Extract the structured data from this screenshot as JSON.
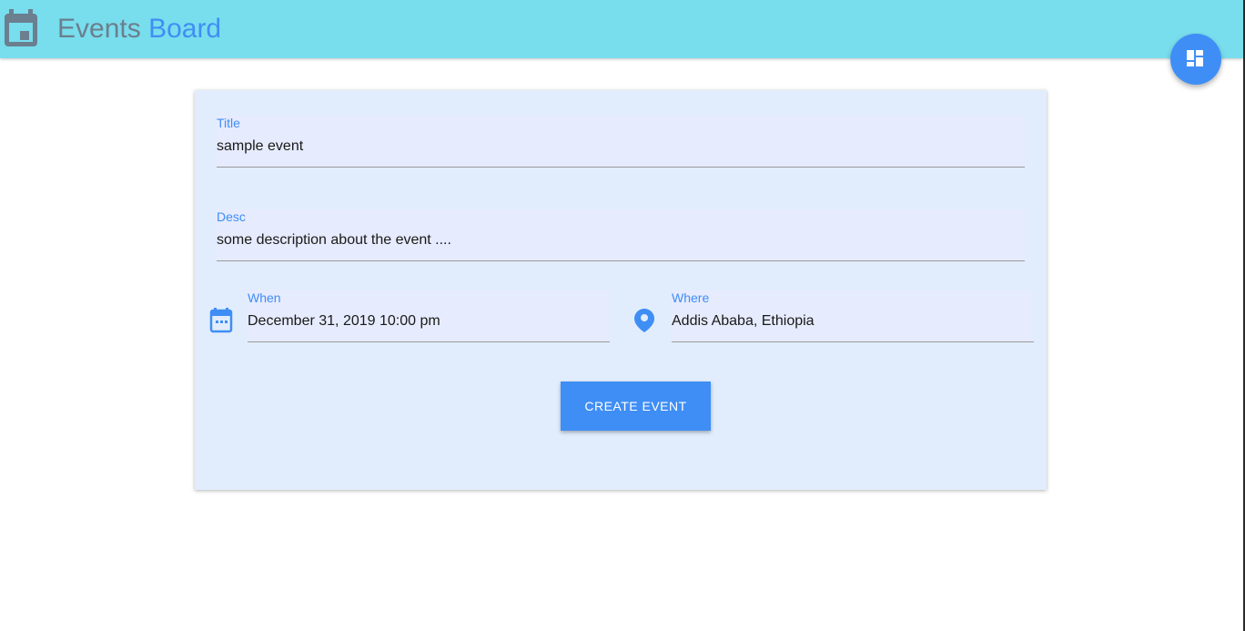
{
  "header": {
    "title_part1": "Events",
    "title_part2": "Board",
    "app_icon": "calendar-icon",
    "fab_icon": "dashboard-icon"
  },
  "form": {
    "title": {
      "label": "Title",
      "value": "sample event"
    },
    "desc": {
      "label": "Desc",
      "value": "some description about the event ...."
    },
    "when": {
      "label": "When",
      "value": "December 31, 2019 10:00 pm",
      "icon": "calendar-icon"
    },
    "where": {
      "label": "Where",
      "value": "Addis Ababa, Ethiopia",
      "icon": "location-pin-icon"
    },
    "submit_label": "CREATE EVENT"
  },
  "colors": {
    "appbar": "#78dded",
    "accent": "#3f8ef5",
    "card": "#e1edfd",
    "title_gray": "#6b7f8e"
  }
}
